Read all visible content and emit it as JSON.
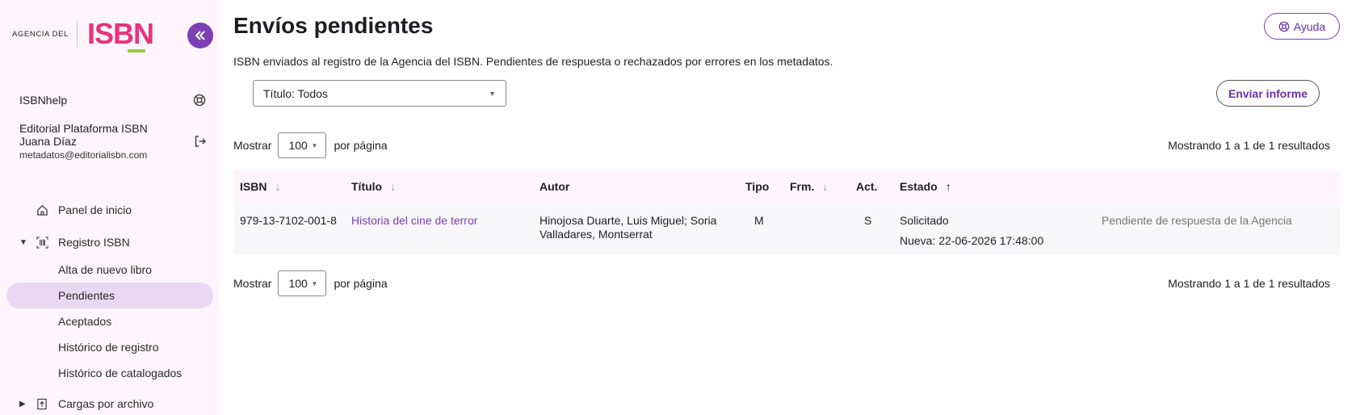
{
  "sidebar": {
    "logo_small": "AGENCIA DEL",
    "logo_big": "ISBN",
    "collapse_icon": "double-chevron-left-icon",
    "help_link": "ISBNhelp",
    "org": "Editorial Plataforma ISBN",
    "user_name": "Juana Díaz",
    "email": "metadatos@editorialisbn.com",
    "nav": [
      {
        "label": "Panel de inicio",
        "icon": "home-icon"
      },
      {
        "label": "Registro ISBN",
        "icon": "barcode-icon"
      },
      {
        "label": "Alta de nuevo libro"
      },
      {
        "label": "Pendientes"
      },
      {
        "label": "Aceptados"
      },
      {
        "label": "Histórico de registro"
      },
      {
        "label": "Histórico de catalogados"
      },
      {
        "label": "Cargas por archivo",
        "icon": "upload-file-icon"
      }
    ]
  },
  "header": {
    "title": "Envíos pendientes",
    "help_label": "Ayuda",
    "subtitle": "ISBN enviados al registro de la Agencia del ISBN. Pendientes de respuesta o rechazados por errores en los metadatos.",
    "filter_value": "Título: Todos",
    "send_report_label": "Enviar informe"
  },
  "pager": {
    "show_label": "Mostrar",
    "per_page_value": "100",
    "per_page_label": "por página",
    "results_text": "Mostrando 1 a 1 de 1 resultados"
  },
  "table": {
    "columns": [
      "ISBN",
      "Título",
      "Autor",
      "Tipo",
      "Frm.",
      "Act.",
      "Estado"
    ],
    "rows": [
      {
        "isbn": "979-13-7102-001-8",
        "title": "Historia del cine de terror",
        "author_line1": "Hinojosa Duarte, Luis Miguel; Soria",
        "author_line2": "Valladares, Montserrat",
        "tipo": "M",
        "frm": "",
        "act": "S",
        "estado": "Solicitado",
        "estado_date": "Nueva: 22-06-2026 17:48:00",
        "note": "Pendiente de respuesta de la Agencia"
      }
    ]
  },
  "colors": {
    "accent": "#7b3fb3",
    "brand_pink": "#e8327c",
    "brand_green": "#9bcb3c",
    "sidebar_bg": "#fdf5fb",
    "active_item_bg": "#ead7f1"
  }
}
